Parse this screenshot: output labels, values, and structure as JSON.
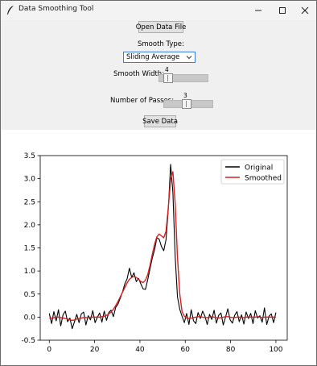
{
  "window": {
    "title": "Data Smoothing Tool"
  },
  "controls": {
    "open_button": "Open Data File",
    "smooth_type_label": "Smooth Type:",
    "smooth_type_value": "Sliding Average",
    "smooth_width_label": "Smooth Width:",
    "smooth_width_value": "4",
    "smooth_width_fraction": 0.1,
    "passes_label": "Number of Passes:",
    "passes_value": "3",
    "passes_fraction": 0.45,
    "save_button": "Save Data"
  },
  "chart_data": {
    "type": "line",
    "x_range": [
      0,
      100
    ],
    "xlim": [
      -4,
      105
    ],
    "ylim": [
      -0.5,
      3.5
    ],
    "x_ticks": [
      "0",
      "20",
      "40",
      "60",
      "80",
      "100"
    ],
    "y_ticks": [
      "-0.5",
      "0.0",
      "0.5",
      "1.0",
      "1.5",
      "2.0",
      "2.5",
      "3.0",
      "3.5"
    ],
    "legend_position": "top-right",
    "grid": false,
    "series": [
      {
        "name": "Original",
        "color": "#000000",
        "values": [
          0.08,
          -0.14,
          0.12,
          -0.08,
          0.16,
          -0.19,
          0.05,
          0.13,
          -0.1,
          -0.02,
          -0.25,
          -0.1,
          0.06,
          -0.12,
          0.07,
          0.11,
          -0.17,
          0.03,
          -0.06,
          0.14,
          -0.12,
          0.0,
          0.09,
          -0.11,
          0.13,
          -0.07,
          0.1,
          0.15,
          0.01,
          0.21,
          0.28,
          0.41,
          0.55,
          0.72,
          0.83,
          1.06,
          0.86,
          0.96,
          0.77,
          0.84,
          0.72,
          0.61,
          0.6,
          0.81,
          1.05,
          1.28,
          1.46,
          1.72,
          1.69,
          1.53,
          1.44,
          1.68,
          2.34,
          3.31,
          2.7,
          1.31,
          0.44,
          0.17,
          0.02,
          -0.12,
          0.08,
          -0.16,
          0.16,
          -0.08,
          -0.14,
          0.1,
          -0.03,
          0.13,
          0.02,
          -0.16,
          0.06,
          -0.05,
          0.15,
          -0.13,
          0.04,
          0.09,
          -0.17,
          0.0,
          0.18,
          -0.06,
          -0.13,
          0.04,
          0.12,
          -0.1,
          0.05,
          -0.15,
          0.11,
          -0.03,
          0.08,
          -0.14,
          0.14,
          -0.02,
          0.03,
          -0.11,
          0.2,
          -0.16,
          0.02,
          0.07,
          -0.12,
          0.1
        ]
      },
      {
        "name": "Smoothed",
        "color": "#d62020",
        "values": [
          -0.02,
          -0.02,
          -0.01,
          0.0,
          0.0,
          -0.01,
          -0.02,
          -0.03,
          -0.04,
          -0.06,
          -0.07,
          -0.06,
          -0.04,
          -0.03,
          -0.02,
          -0.01,
          -0.01,
          -0.01,
          0.0,
          0.0,
          0.0,
          0.0,
          0.0,
          0.01,
          0.02,
          0.04,
          0.07,
          0.11,
          0.17,
          0.25,
          0.34,
          0.44,
          0.54,
          0.64,
          0.74,
          0.82,
          0.86,
          0.88,
          0.86,
          0.82,
          0.77,
          0.75,
          0.8,
          0.92,
          1.12,
          1.36,
          1.58,
          1.74,
          1.8,
          1.76,
          1.72,
          1.86,
          2.38,
          2.98,
          3.15,
          2.45,
          1.3,
          0.5,
          0.12,
          0.02,
          -0.02,
          -0.03,
          -0.02,
          -0.01,
          0.0,
          0.01,
          0.01,
          0.0,
          -0.01,
          -0.01,
          0.0,
          0.01,
          0.0,
          -0.01,
          -0.02,
          -0.01,
          0.0,
          0.01,
          0.01,
          0.0,
          -0.01,
          -0.01,
          0.0,
          0.0,
          -0.01,
          -0.01,
          0.0,
          0.0,
          0.0,
          0.0,
          0.0,
          0.01,
          0.0,
          -0.01,
          0.0,
          0.0,
          0.0,
          0.0,
          0.0,
          0.0
        ]
      }
    ]
  }
}
